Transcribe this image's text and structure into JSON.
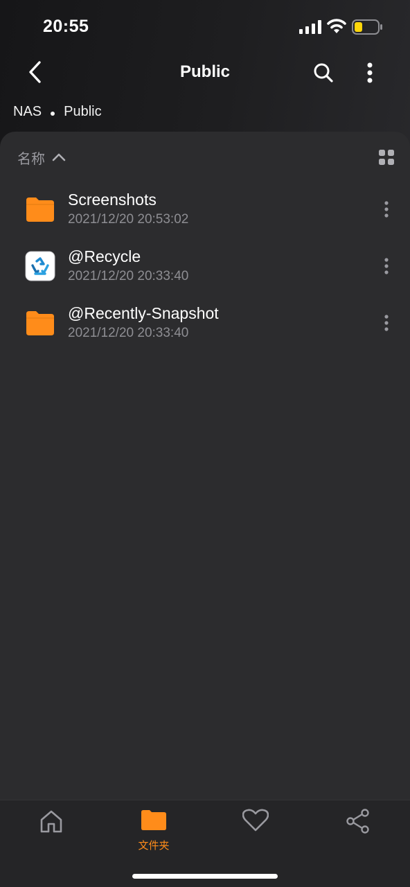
{
  "status_bar": {
    "time": "20:55"
  },
  "nav": {
    "title": "Public"
  },
  "breadcrumb": {
    "items": [
      "NAS",
      "Public"
    ]
  },
  "sort": {
    "label": "名称",
    "direction": "ascending"
  },
  "files": [
    {
      "name": "Screenshots",
      "date": "2021/12/20 20:53:02",
      "icon": "folder-icon"
    },
    {
      "name": "@Recycle",
      "date": "2021/12/20 20:33:40",
      "icon": "recycle-bin-icon"
    },
    {
      "name": "@Recently-Snapshot",
      "date": "2021/12/20 20:33:40",
      "icon": "folder-icon"
    }
  ],
  "tabs": [
    {
      "id": "home",
      "icon": "home-icon",
      "label": ""
    },
    {
      "id": "folders",
      "icon": "folder-icon",
      "label": "文件夹",
      "active": true
    },
    {
      "id": "favorites",
      "icon": "heart-icon",
      "label": ""
    },
    {
      "id": "share",
      "icon": "share-icon",
      "label": ""
    }
  ],
  "colors": {
    "accent": "#ff8c1a",
    "background": "#1c1c1e",
    "panel": "#2c2c2e",
    "secondary_text": "#8e8e93",
    "battery_fill": "#ffd60a"
  }
}
